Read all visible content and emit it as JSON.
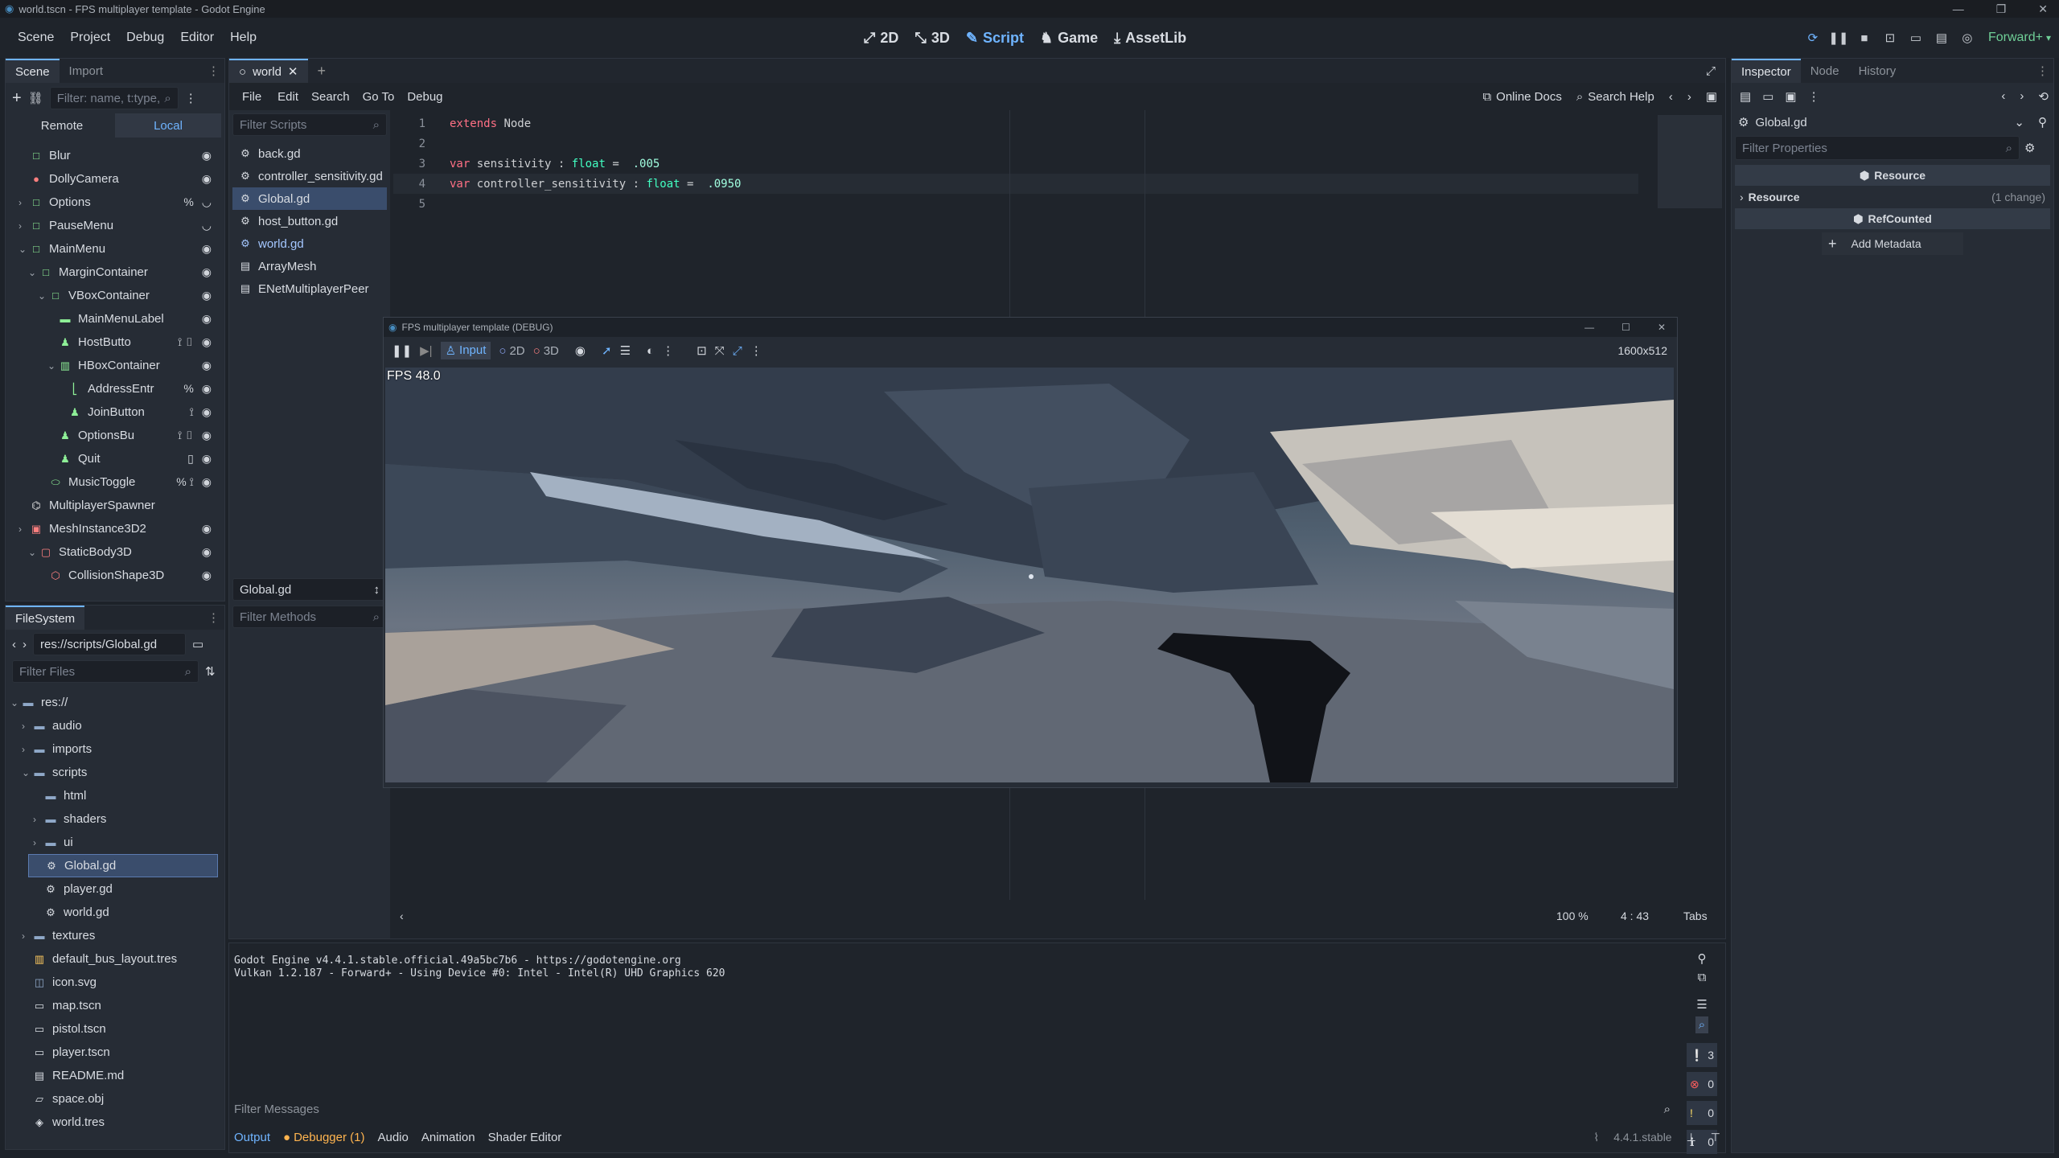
{
  "window": {
    "title": "world.tscn - FPS multiplayer template - Godot Engine"
  },
  "menubar": {
    "items": [
      "Scene",
      "Project",
      "Debug",
      "Editor",
      "Help"
    ],
    "workspaces": [
      {
        "label": "2D",
        "icon": "2d-icon"
      },
      {
        "label": "3D",
        "icon": "3d-icon"
      },
      {
        "label": "Script",
        "icon": "script-icon"
      },
      {
        "label": "Game",
        "icon": "game-icon"
      },
      {
        "label": "AssetLib",
        "icon": "assetlib-icon"
      }
    ],
    "renderer": "Forward+",
    "accent": "#6fb4ff"
  },
  "scene_dock": {
    "tabs": [
      "Scene",
      "Import"
    ],
    "filter_placeholder": "Filter: name, t:type,",
    "remote_label": "Remote",
    "local_label": "Local",
    "nodes": [
      {
        "label": "Blur",
        "indent": 2,
        "color": "#8eef97",
        "icon": "□",
        "vis": true
      },
      {
        "label": "DollyCamera",
        "indent": 2,
        "color": "#fc7f7f",
        "icon": "●",
        "vis": true
      },
      {
        "label": "Options",
        "indent": 2,
        "color": "#8eef97",
        "icon": "□",
        "arrow": "›",
        "extra": "%",
        "hidden": true
      },
      {
        "label": "PauseMenu",
        "indent": 2,
        "color": "#8eef97",
        "icon": "□",
        "arrow": "›",
        "hidden": true
      },
      {
        "label": "MainMenu",
        "indent": 2,
        "color": "#8eef97",
        "icon": "□",
        "arrow": "⌄",
        "vis": true
      },
      {
        "label": "MarginContainer",
        "indent": 3,
        "color": "#8eef97",
        "icon": "□",
        "arrow": "⌄",
        "vis": true
      },
      {
        "label": "VBoxContainer",
        "indent": 4,
        "color": "#8eef97",
        "icon": "□",
        "arrow": "⌄",
        "vis": true
      },
      {
        "label": "MainMenuLabel",
        "indent": 5,
        "color": "#8eef97",
        "icon": "▬",
        "vis": true
      },
      {
        "label": "HostButto",
        "indent": 5,
        "color": "#8eef97",
        "icon": "♟",
        "extra": "⟟ ▯",
        "vis": true
      },
      {
        "label": "HBoxContainer",
        "indent": 5,
        "color": "#8eef97",
        "icon": "▥",
        "arrow": "⌄",
        "vis": true
      },
      {
        "label": "AddressEntr",
        "indent": 6,
        "color": "#8eef97",
        "icon": "⎣",
        "extra": "%",
        "vis": true
      },
      {
        "label": "JoinButton",
        "indent": 6,
        "color": "#8eef97",
        "icon": "♟",
        "extra": "⟟",
        "vis": true
      },
      {
        "label": "OptionsBu",
        "indent": 5,
        "color": "#8eef97",
        "icon": "♟",
        "extra": "⟟ ▯",
        "vis": true
      },
      {
        "label": "Quit",
        "indent": 5,
        "color": "#8eef97",
        "icon": "♟",
        "extra": "▯",
        "vis": true
      },
      {
        "label": "MusicToggle",
        "indent": 4,
        "color": "#8eef97",
        "icon": "⬭",
        "extra": "% ⟟",
        "vis": true
      },
      {
        "label": "MultiplayerSpawner",
        "indent": 2,
        "color": "#e0e0e0",
        "icon": "⌬"
      },
      {
        "label": "MeshInstance3D2",
        "indent": 2,
        "color": "#fc7f7f",
        "icon": "▣",
        "arrow": "›",
        "vis": true
      },
      {
        "label": "StaticBody3D",
        "indent": 3,
        "color": "#fc7f7f",
        "icon": "▢",
        "arrow": "⌄",
        "vis": true
      },
      {
        "label": "CollisionShape3D",
        "indent": 4,
        "color": "#fc7f7f",
        "icon": "⬡",
        "vis": true
      }
    ]
  },
  "filesystem": {
    "tab": "FileSystem",
    "path": "res://scripts/Global.gd",
    "filter_placeholder": "Filter Files",
    "items": [
      {
        "label": "res://",
        "indent": 1,
        "arrow": "⌄",
        "icon": "folder"
      },
      {
        "label": "audio",
        "indent": 2,
        "arrow": "›",
        "icon": "folder"
      },
      {
        "label": "imports",
        "indent": 2,
        "arrow": "›",
        "icon": "folder"
      },
      {
        "label": "scripts",
        "indent": 2,
        "arrow": "⌄",
        "icon": "folder"
      },
      {
        "label": "html",
        "indent": 3,
        "icon": "folder"
      },
      {
        "label": "shaders",
        "indent": 3,
        "arrow": "›",
        "icon": "folder"
      },
      {
        "label": "ui",
        "indent": 3,
        "arrow": "›",
        "icon": "folder"
      },
      {
        "label": "Global.gd",
        "indent": 3,
        "icon": "gear",
        "selected": true
      },
      {
        "label": "player.gd",
        "indent": 3,
        "icon": "gear"
      },
      {
        "label": "world.gd",
        "indent": 3,
        "icon": "gear"
      },
      {
        "label": "textures",
        "indent": 2,
        "arrow": "›",
        "icon": "folder"
      },
      {
        "label": "default_bus_layout.tres",
        "indent": 2,
        "icon": "bus"
      },
      {
        "label": "icon.svg",
        "indent": 2,
        "icon": "img"
      },
      {
        "label": "map.tscn",
        "indent": 2,
        "icon": "scene"
      },
      {
        "label": "pistol.tscn",
        "indent": 2,
        "icon": "scene"
      },
      {
        "label": "player.tscn",
        "indent": 2,
        "icon": "scene"
      },
      {
        "label": "README.md",
        "indent": 2,
        "icon": "doc"
      },
      {
        "label": "space.obj",
        "indent": 2,
        "icon": "mesh"
      },
      {
        "label": "world.tres",
        "indent": 2,
        "icon": "env"
      }
    ]
  },
  "editor": {
    "scene_tab": "world",
    "menus": [
      "File",
      "Edit",
      "Search",
      "Go To",
      "Debug"
    ],
    "online_docs": "Online Docs",
    "search_help": "Search Help",
    "filter_scripts": "Filter Scripts",
    "scripts": [
      "back.gd",
      "controller_sensitivity.gd",
      "Global.gd",
      "host_button.gd",
      "world.gd",
      "ArrayMesh",
      "ENetMultiplayerPeer"
    ],
    "current_script": "Global.gd",
    "filter_methods": "Filter Methods",
    "code": [
      {
        "n": "1",
        "kw": "extends",
        "rest": " Node"
      },
      {
        "n": "2"
      },
      {
        "n": "3",
        "kw": "var",
        "name": " sensitivity : ",
        "type": "float",
        "eq": " =  ",
        "val": ".005"
      },
      {
        "n": "4",
        "kw": "var",
        "name": " controller_sensitivity : ",
        "type": "float",
        "eq": " =  ",
        "val": ".0950"
      },
      {
        "n": "5"
      }
    ],
    "zoom": "100 %",
    "cursor": "4 :  43",
    "indent_mode": "Tabs"
  },
  "game_window": {
    "title": "FPS multiplayer template (DEBUG)",
    "input_label": "Input",
    "btn_2d": "2D",
    "btn_3d": "3D",
    "resolution": "1600x512",
    "fps": "FPS 48.0"
  },
  "output": {
    "lines": [
      "Godot Engine v4.4.1.stable.official.49a5bc7b6 - https://godotengine.org",
      "Vulkan 1.2.187 - Forward+ - Using Device #0: Intel - Intel(R) UHD Graphics 620"
    ],
    "filter_placeholder": "Filter Messages",
    "counts": [
      "3",
      "0",
      "0",
      "0"
    ],
    "bottom_tabs": [
      "Output",
      "Debugger (1)",
      "Audio",
      "Animation",
      "Shader Editor"
    ],
    "version": "4.4.1.stable"
  },
  "inspector": {
    "tabs": [
      "Inspector",
      "Node",
      "History"
    ],
    "resource_name": "Global.gd",
    "filter_placeholder": "Filter Properties",
    "section_resource": "Resource",
    "prop_resource": "Resource",
    "prop_change": "(1 change)",
    "section_refcounted": "RefCounted",
    "add_metadata": "Add Metadata"
  }
}
